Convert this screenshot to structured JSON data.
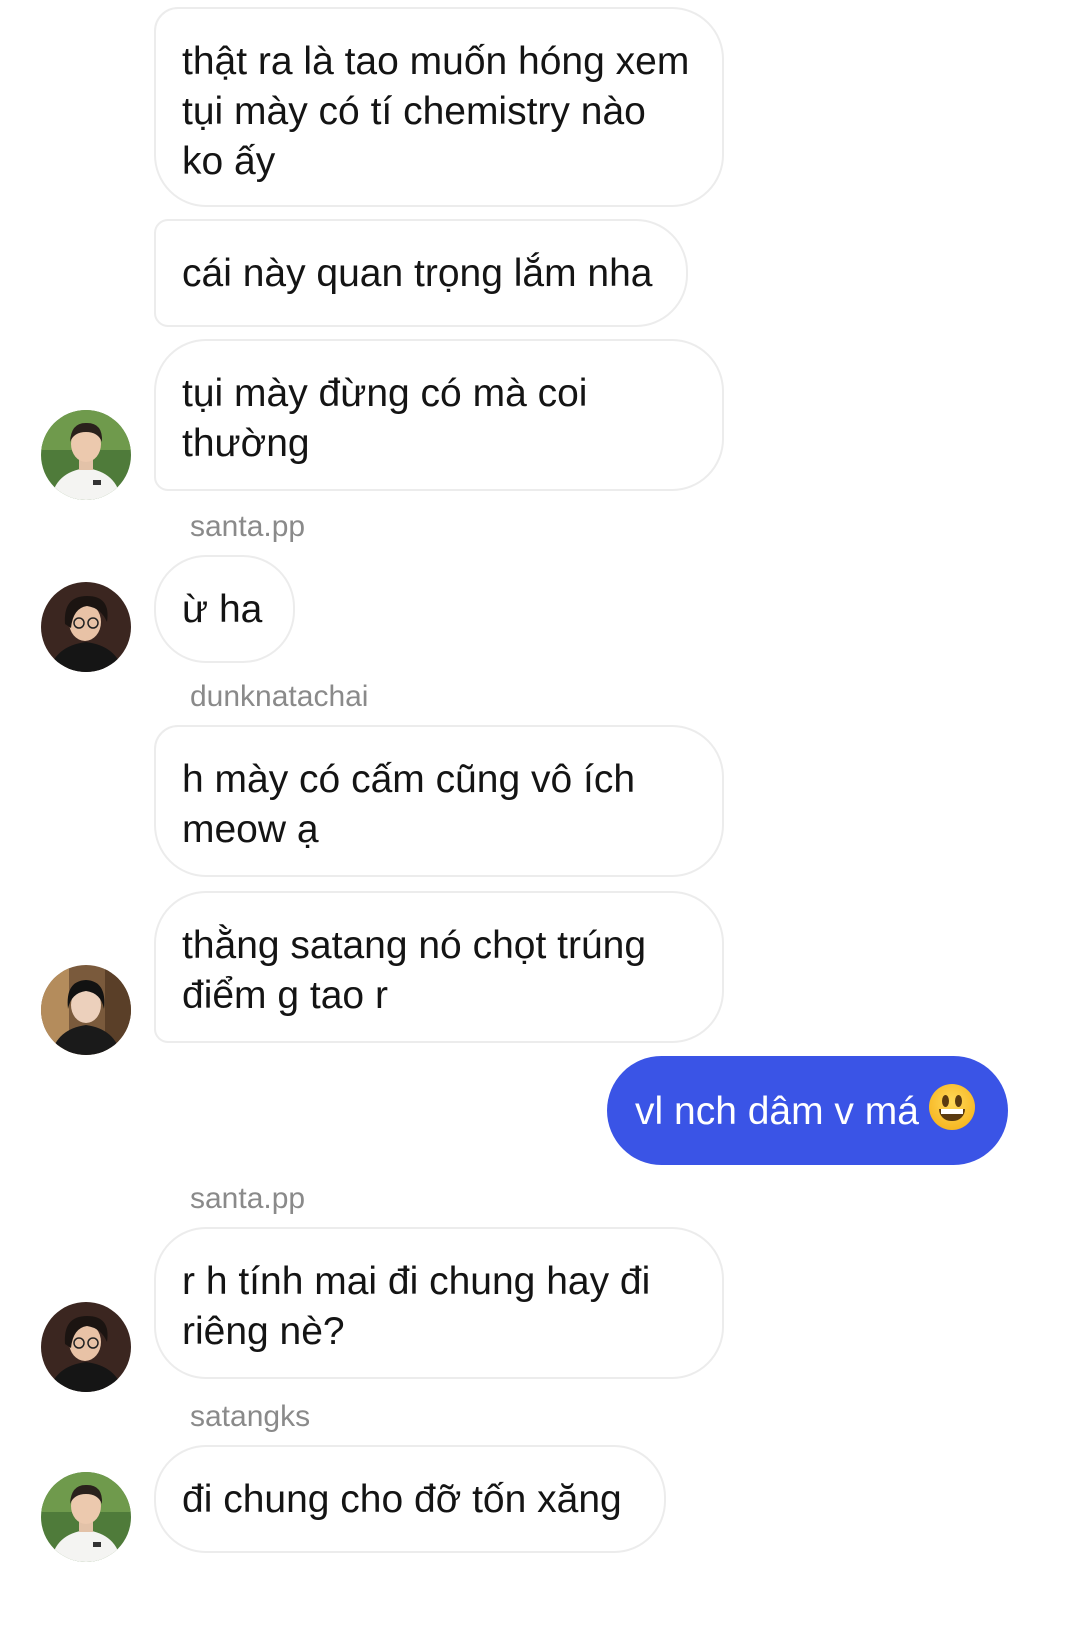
{
  "messages": [
    {
      "sender": "",
      "text": "thật ra là tao muốn hóng xem tụi mày có tí chemistry nào ko ấy",
      "direction": "incoming"
    },
    {
      "sender": "",
      "text": "cái này quan trọng lắm nha",
      "direction": "incoming"
    },
    {
      "sender": "",
      "text": "tụi mày đừng có mà coi thường",
      "direction": "incoming"
    },
    {
      "sender": "santa.pp",
      "text": "ừ ha",
      "direction": "incoming"
    },
    {
      "sender": "dunknatachai",
      "text": "h mày có cấm cũng vô ích meow ạ",
      "direction": "incoming"
    },
    {
      "sender": "",
      "text": "thằng satang nó chọt trúng điểm g tao r",
      "direction": "incoming"
    },
    {
      "sender": "",
      "text": "vl nch dâm v má",
      "emoji": "grinning-face-emoji",
      "direction": "outgoing"
    },
    {
      "sender": "santa.pp",
      "text": "r h tính mai đi chung hay đi riêng nè?",
      "direction": "incoming"
    },
    {
      "sender": "satangks",
      "text": "đi chung cho đỡ tốn xăng",
      "direction": "incoming"
    }
  ],
  "colors": {
    "outgoing_bubble": "#3a54e6",
    "incoming_border": "#ececec",
    "sender_label": "#8a8a8a"
  },
  "avatars": [
    "avatar-boy-white-shirt",
    "avatar-dark-hair",
    "avatar-dark-hair-2",
    "avatar-dark-hair",
    "avatar-boy-white-shirt"
  ]
}
